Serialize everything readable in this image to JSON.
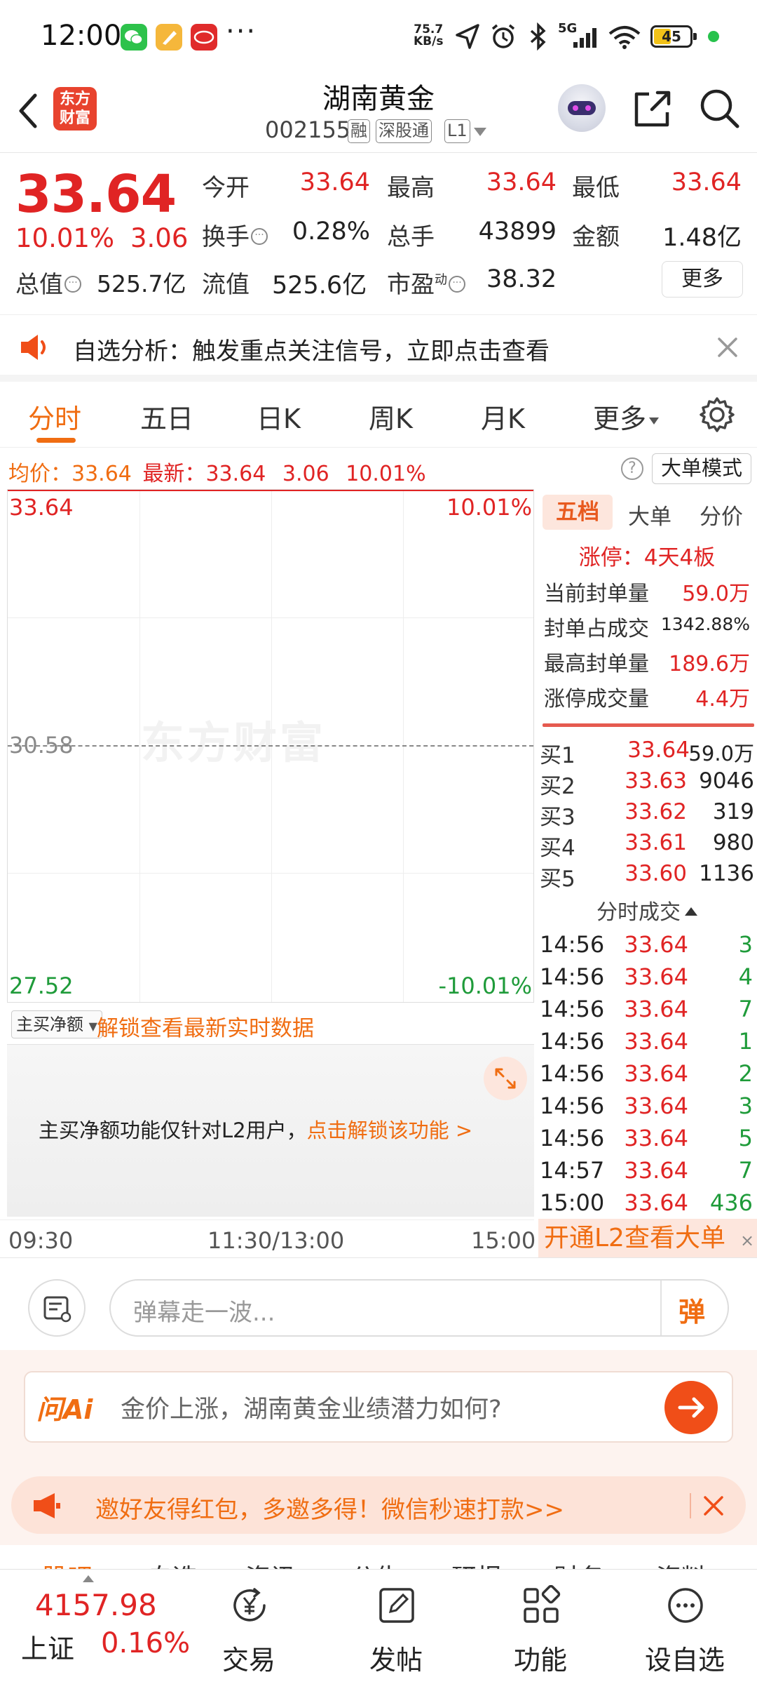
{
  "status_bar": {
    "time": "12:00",
    "net_speed_value": "75.7",
    "net_speed_unit": "KB/s",
    "signal_label": "5G",
    "battery": "45",
    "dots": "···"
  },
  "header": {
    "logo_line1": "东方",
    "logo_line2": "财富",
    "stock_name": "湖南黄金",
    "stock_code": "002155",
    "tags": [
      "融",
      "深股通",
      "L1"
    ]
  },
  "quote": {
    "price": "33.64",
    "change_pct": "10.01%",
    "change": "3.06",
    "open_label": "今开",
    "open_value": "33.64",
    "high_label": "最高",
    "high_value": "33.64",
    "low_label": "最低",
    "low_value": "33.64",
    "turnover_label": "换手",
    "turnover_value": "0.28%",
    "volume_label": "总手",
    "volume_value": "43899",
    "amount_label": "金额",
    "amount_value": "1.48亿",
    "mktcap_label": "总值",
    "mktcap_value": "525.7亿",
    "float_label": "流值",
    "float_value": "525.6亿",
    "pe_label": "市盈",
    "pe_sup": "动",
    "pe_value": "38.32",
    "more_button": "更多"
  },
  "alert": {
    "text": "自选分析：触发重点关注信号，立即点击查看"
  },
  "tabs": {
    "items": [
      "分时",
      "五日",
      "日K",
      "周K",
      "月K",
      "更多"
    ],
    "active_index": 0
  },
  "info_row": {
    "avg_label": "均价：",
    "avg_value": "33.64",
    "latest_label": "最新：",
    "latest_value": "33.64",
    "latest_change": "3.06",
    "latest_pct": "10.01%",
    "help": "?",
    "mode_button": "大单模式"
  },
  "chart_data": {
    "type": "line",
    "y_labels_left": [
      "33.64",
      "30.58",
      "27.52"
    ],
    "y_labels_right": [
      "10.01%",
      "-10.01%"
    ],
    "ylim": [
      27.52,
      33.64
    ],
    "reference_price": 30.58,
    "x_labels": [
      "09:30",
      "11:30/13:00",
      "15:00"
    ],
    "series": [
      {
        "values": [
          33.64,
          33.64
        ]
      }
    ],
    "watermark": "东方财富"
  },
  "net_buy": {
    "select_label": "主买净额",
    "unlock_link": "解锁查看最新实时数据",
    "message": "主买净额功能仅针对L2用户，",
    "message_link": "点击解锁该功能 >"
  },
  "right_panel": {
    "tabs": [
      "五档",
      "大单",
      "分价"
    ],
    "limit_up": "涨停：4天4板",
    "stats": [
      {
        "label": "当前封单量",
        "value": "59.0万"
      },
      {
        "label": "封单占成交",
        "value": "1342.88%"
      },
      {
        "label": "最高封单量",
        "value": "189.6万"
      },
      {
        "label": "涨停成交量",
        "value": "4.4万"
      }
    ],
    "bids": [
      {
        "level": "买1",
        "price": "33.64",
        "volume": "59.0万"
      },
      {
        "level": "买2",
        "price": "33.63",
        "volume": "9046"
      },
      {
        "level": "买3",
        "price": "33.62",
        "volume": "319"
      },
      {
        "level": "买4",
        "price": "33.61",
        "volume": "980"
      },
      {
        "level": "买5",
        "price": "33.60",
        "volume": "1136"
      }
    ],
    "ticks_title": "分时成交",
    "ticks": [
      {
        "time": "14:56",
        "price": "33.64",
        "volume": "3"
      },
      {
        "time": "14:56",
        "price": "33.64",
        "volume": "4"
      },
      {
        "time": "14:56",
        "price": "33.64",
        "volume": "7"
      },
      {
        "time": "14:56",
        "price": "33.64",
        "volume": "1"
      },
      {
        "time": "14:56",
        "price": "33.64",
        "volume": "2"
      },
      {
        "time": "14:56",
        "price": "33.64",
        "volume": "3"
      },
      {
        "time": "14:56",
        "price": "33.64",
        "volume": "5"
      },
      {
        "time": "14:57",
        "price": "33.64",
        "volume": "7"
      },
      {
        "time": "15:00",
        "price": "33.64",
        "volume": "436"
      }
    ],
    "l2_banner": "开通L2查看大单",
    "close": "×"
  },
  "barrage": {
    "placeholder": "弹幕走一波...",
    "button": "弹"
  },
  "ai": {
    "logo": "问Ai",
    "question": "金价上涨，湖南黄金业绩潜力如何?"
  },
  "invite": {
    "text": "邀好友得红包，多邀多得！微信秒速打款>>"
  },
  "peek_tabs": [
    "股吧",
    "自选",
    "资讯",
    "公告",
    "研报",
    "财务",
    "资料"
  ],
  "bottom_nav": {
    "index_value": "4157.98",
    "index_name": "上证",
    "index_pct": "0.16%",
    "items": [
      "交易",
      "发帖",
      "功能",
      "设自选"
    ]
  },
  "colors": {
    "up": "#e02424",
    "down": "#1f9b3a",
    "accent": "#f06d12"
  }
}
